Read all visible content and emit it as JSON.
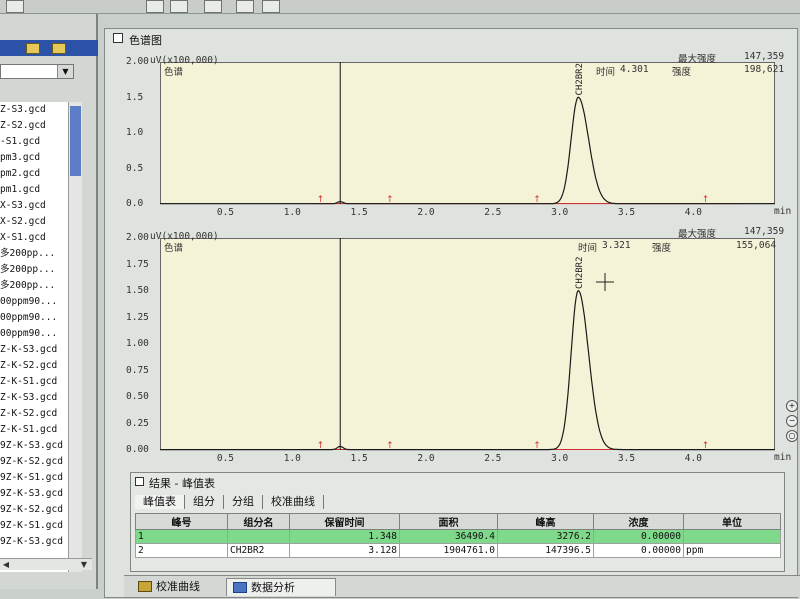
{
  "left_panel": {
    "files": [
      "Z-S3.gcd",
      "Z-S2.gcd",
      "-S1.gcd",
      "pm3.gcd",
      "pm2.gcd",
      "pm1.gcd",
      "X-S3.gcd",
      "X-S2.gcd",
      "X-S1.gcd",
      "多200pp...",
      "多200pp...",
      "多200pp...",
      "00ppm90...",
      "00ppm90...",
      "00ppm90...",
      "Z-K-S3.gcd",
      "Z-K-S2.gcd",
      "Z-K-S1.gcd",
      "Z-K-S3.gcd",
      "Z-K-S2.gcd",
      "Z-K-S1.gcd",
      "9Z-K-S3.gcd",
      "9Z-K-S2.gcd",
      "9Z-K-S1.gcd",
      "9Z-K-S3.gcd",
      "9Z-K-S2.gcd",
      "9Z-K-S1.gcd",
      "9Z-K-S3.gcd"
    ]
  },
  "window": {
    "title": "色谱图"
  },
  "top_plot": {
    "title": "色谱",
    "unit": "uV(x100,000)",
    "max_label": "最大强度",
    "max_value": "147,359",
    "readout_time_label": "时间",
    "readout_time": "4.301",
    "readout_intensity_label": "强度",
    "readout_intensity": "198,621",
    "peak_label": "CH2BR2",
    "y_ticks": [
      "2.00",
      "1.5",
      "1.0",
      "0.5",
      "0.0"
    ],
    "x_ticks": [
      "0.5",
      "1.0",
      "1.5",
      "2.0",
      "2.5",
      "3.0",
      "3.5",
      "4.0"
    ],
    "x_unit": "min"
  },
  "bottom_plot": {
    "title": "色谱",
    "unit": "uV(x100,000)",
    "max_label": "最大强度",
    "max_value": "147,359",
    "readout_time_label": "时间",
    "readout_time": "3.321",
    "readout_intensity_label": "强度",
    "readout_intensity": "155,064",
    "peak_label": "CH2BR2",
    "y_ticks": [
      "2.00",
      "1.75",
      "1.50",
      "1.25",
      "1.00",
      "0.75",
      "0.50",
      "0.25",
      "0.00"
    ],
    "x_ticks": [
      "0.5",
      "1.0",
      "1.5",
      "2.0",
      "2.5",
      "3.0",
      "3.5",
      "4.0"
    ],
    "x_unit": "min"
  },
  "results": {
    "title": "结果 - 峰值表",
    "tabs": [
      "峰值表",
      "组分",
      "分组",
      "校准曲线"
    ],
    "columns": [
      "峰号",
      "组分名",
      "保留时间",
      "面积",
      "峰高",
      "浓度",
      "单位"
    ],
    "rows": [
      {
        "no": "1",
        "name": "",
        "rt": "1.348",
        "area": "36490.4",
        "height": "3276.2",
        "conc": "0.00000",
        "unit": ""
      },
      {
        "no": "2",
        "name": "CH2BR2",
        "rt": "3.128",
        "area": "1904761.0",
        "height": "147396.5",
        "conc": "0.00000",
        "unit": "ppm"
      }
    ]
  },
  "bottom_tabs": [
    "校准曲线",
    "数据分析"
  ],
  "chart_data": [
    {
      "type": "line",
      "title": "色谱",
      "xlabel": "min",
      "ylabel": "uV(x100,000)",
      "xlim": [
        0.0,
        4.6
      ],
      "ylim": [
        0.0,
        2.0
      ],
      "peaks": [
        {
          "label": "",
          "rt": 1.348,
          "height": 0.03
        },
        {
          "label": "CH2BR2",
          "rt": 3.128,
          "height": 1.5
        }
      ]
    },
    {
      "type": "line",
      "title": "色谱",
      "xlabel": "min",
      "ylabel": "uV(x100,000)",
      "xlim": [
        0.0,
        4.6
      ],
      "ylim": [
        0.0,
        2.0
      ],
      "peaks": [
        {
          "label": "",
          "rt": 1.348,
          "height": 0.03
        },
        {
          "label": "CH2BR2",
          "rt": 3.128,
          "height": 1.5
        }
      ]
    }
  ]
}
